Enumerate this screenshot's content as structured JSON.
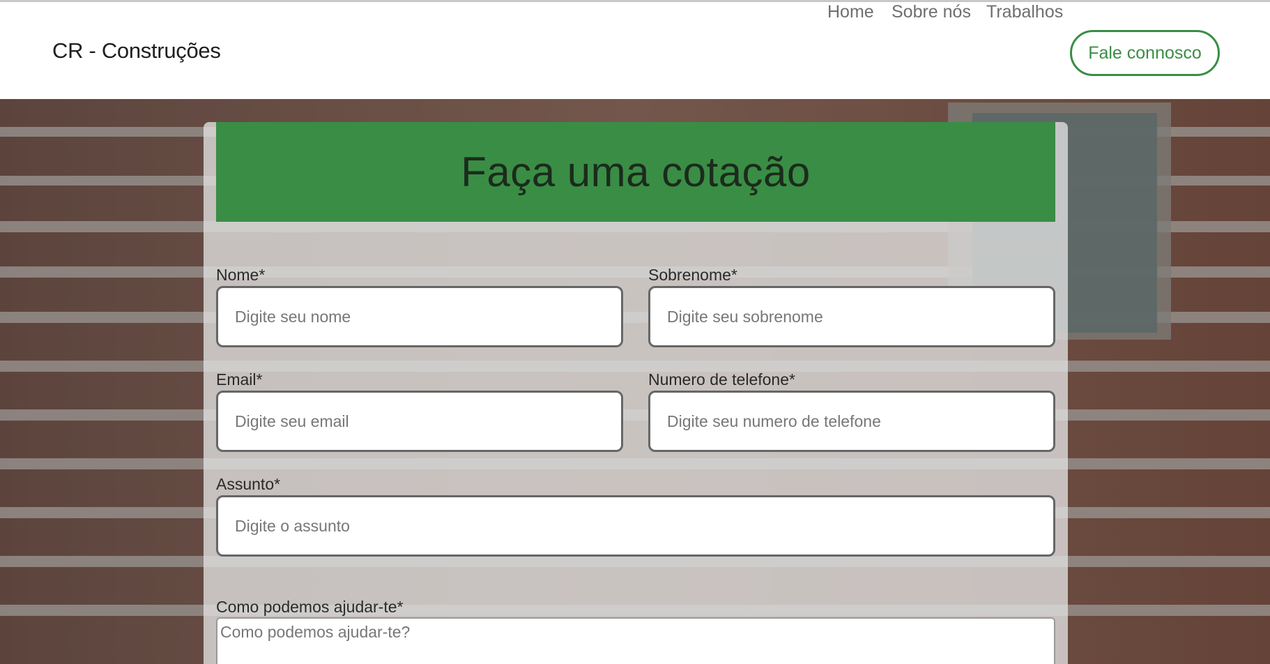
{
  "header": {
    "brand": "CR - Construções",
    "nav": {
      "home": "Home",
      "about": "Sobre nós",
      "works": "Trabalhos",
      "contact_button": "Fale connosco"
    }
  },
  "form": {
    "title": "Faça uma cotação",
    "fields": {
      "first_name": {
        "label": "Nome*",
        "placeholder": "Digite seu nome"
      },
      "last_name": {
        "label": "Sobrenome*",
        "placeholder": "Digite seu sobrenome"
      },
      "email": {
        "label": "Email*",
        "placeholder": "Digite seu email"
      },
      "phone": {
        "label": "Numero de telefone*",
        "placeholder": "Digite seu numero de telefone"
      },
      "subject": {
        "label": "Assunto*",
        "placeholder": "Digite o assunto"
      },
      "message": {
        "label": "Como podemos ajudar-te*",
        "placeholder": "Como podemos ajudar-te?"
      }
    }
  },
  "colors": {
    "accent": "#3a8d45",
    "header_text": "#1b2b1c",
    "nav_text": "#6f6f6f"
  }
}
